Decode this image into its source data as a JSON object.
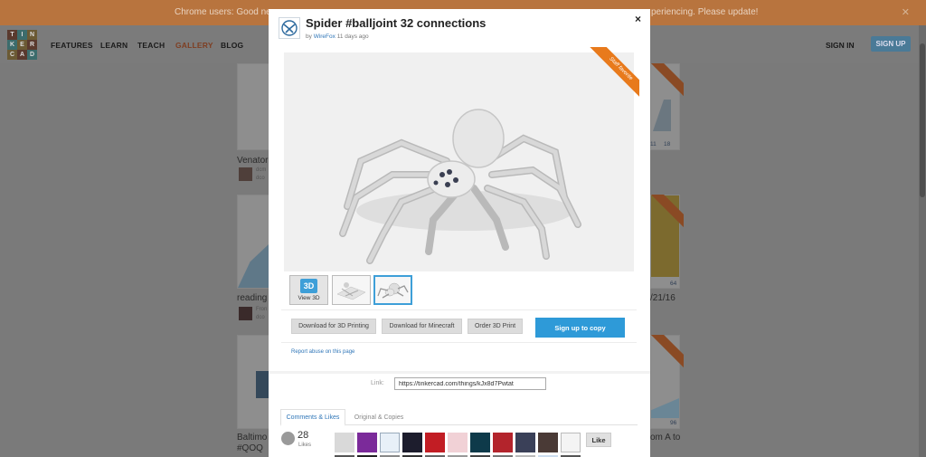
{
  "banner": {
    "text_left": "Chrome users: Good news",
    "text_right": "periencing. Please update!",
    "close_glyph": "✕"
  },
  "nav": {
    "logo_letters": [
      "T",
      "I",
      "N",
      "K",
      "E",
      "R",
      "C",
      "A",
      "D"
    ],
    "links": [
      "FEATURES",
      "LEARN",
      "TEACH",
      "GALLERY",
      "BLOG"
    ],
    "active": "GALLERY",
    "sign_in": "SIGN IN",
    "sign_up": "SIGN UP"
  },
  "gallery": {
    "cards": [
      {
        "title": "Venator"
      },
      {
        "title": "reading"
      },
      {
        "title": "Baltimo"
      },
      {
        "title": "#QOQ"
      }
    ],
    "small_texts": [
      "dcm",
      "dco",
      "Fron",
      "dco"
    ],
    "stats": [
      "11",
      "18",
      "64",
      "96"
    ],
    "right_titles": [
      "/21/16",
      "om A to"
    ]
  },
  "modal": {
    "title": "Spider #balljoint 32 connections",
    "by_prefix": "by",
    "author": "WireFox",
    "age": "11 days ago",
    "close_glyph": "×",
    "ribbon": "Staff favorite",
    "view3d_badge": "3D",
    "view3d_label": "View 3D",
    "buttons": {
      "download_3d": "Download for 3D Printing",
      "download_minecraft": "Download for Minecraft",
      "order": "Order 3D Print",
      "signup_copy": "Sign up to copy"
    },
    "report": "Report abuse on this page",
    "link_label": "Link:",
    "link_value": "https://tinkercad.com/things/kJx8d7Pwtat",
    "tabs": [
      "Comments & Likes",
      "Original & Copies"
    ],
    "likes_count": "28",
    "likes_label": "Likes",
    "like_button": "Like"
  },
  "colors": {
    "accent": "#2e9ad8",
    "ribbon": "#e87a1c",
    "banner": "#b8743e"
  }
}
